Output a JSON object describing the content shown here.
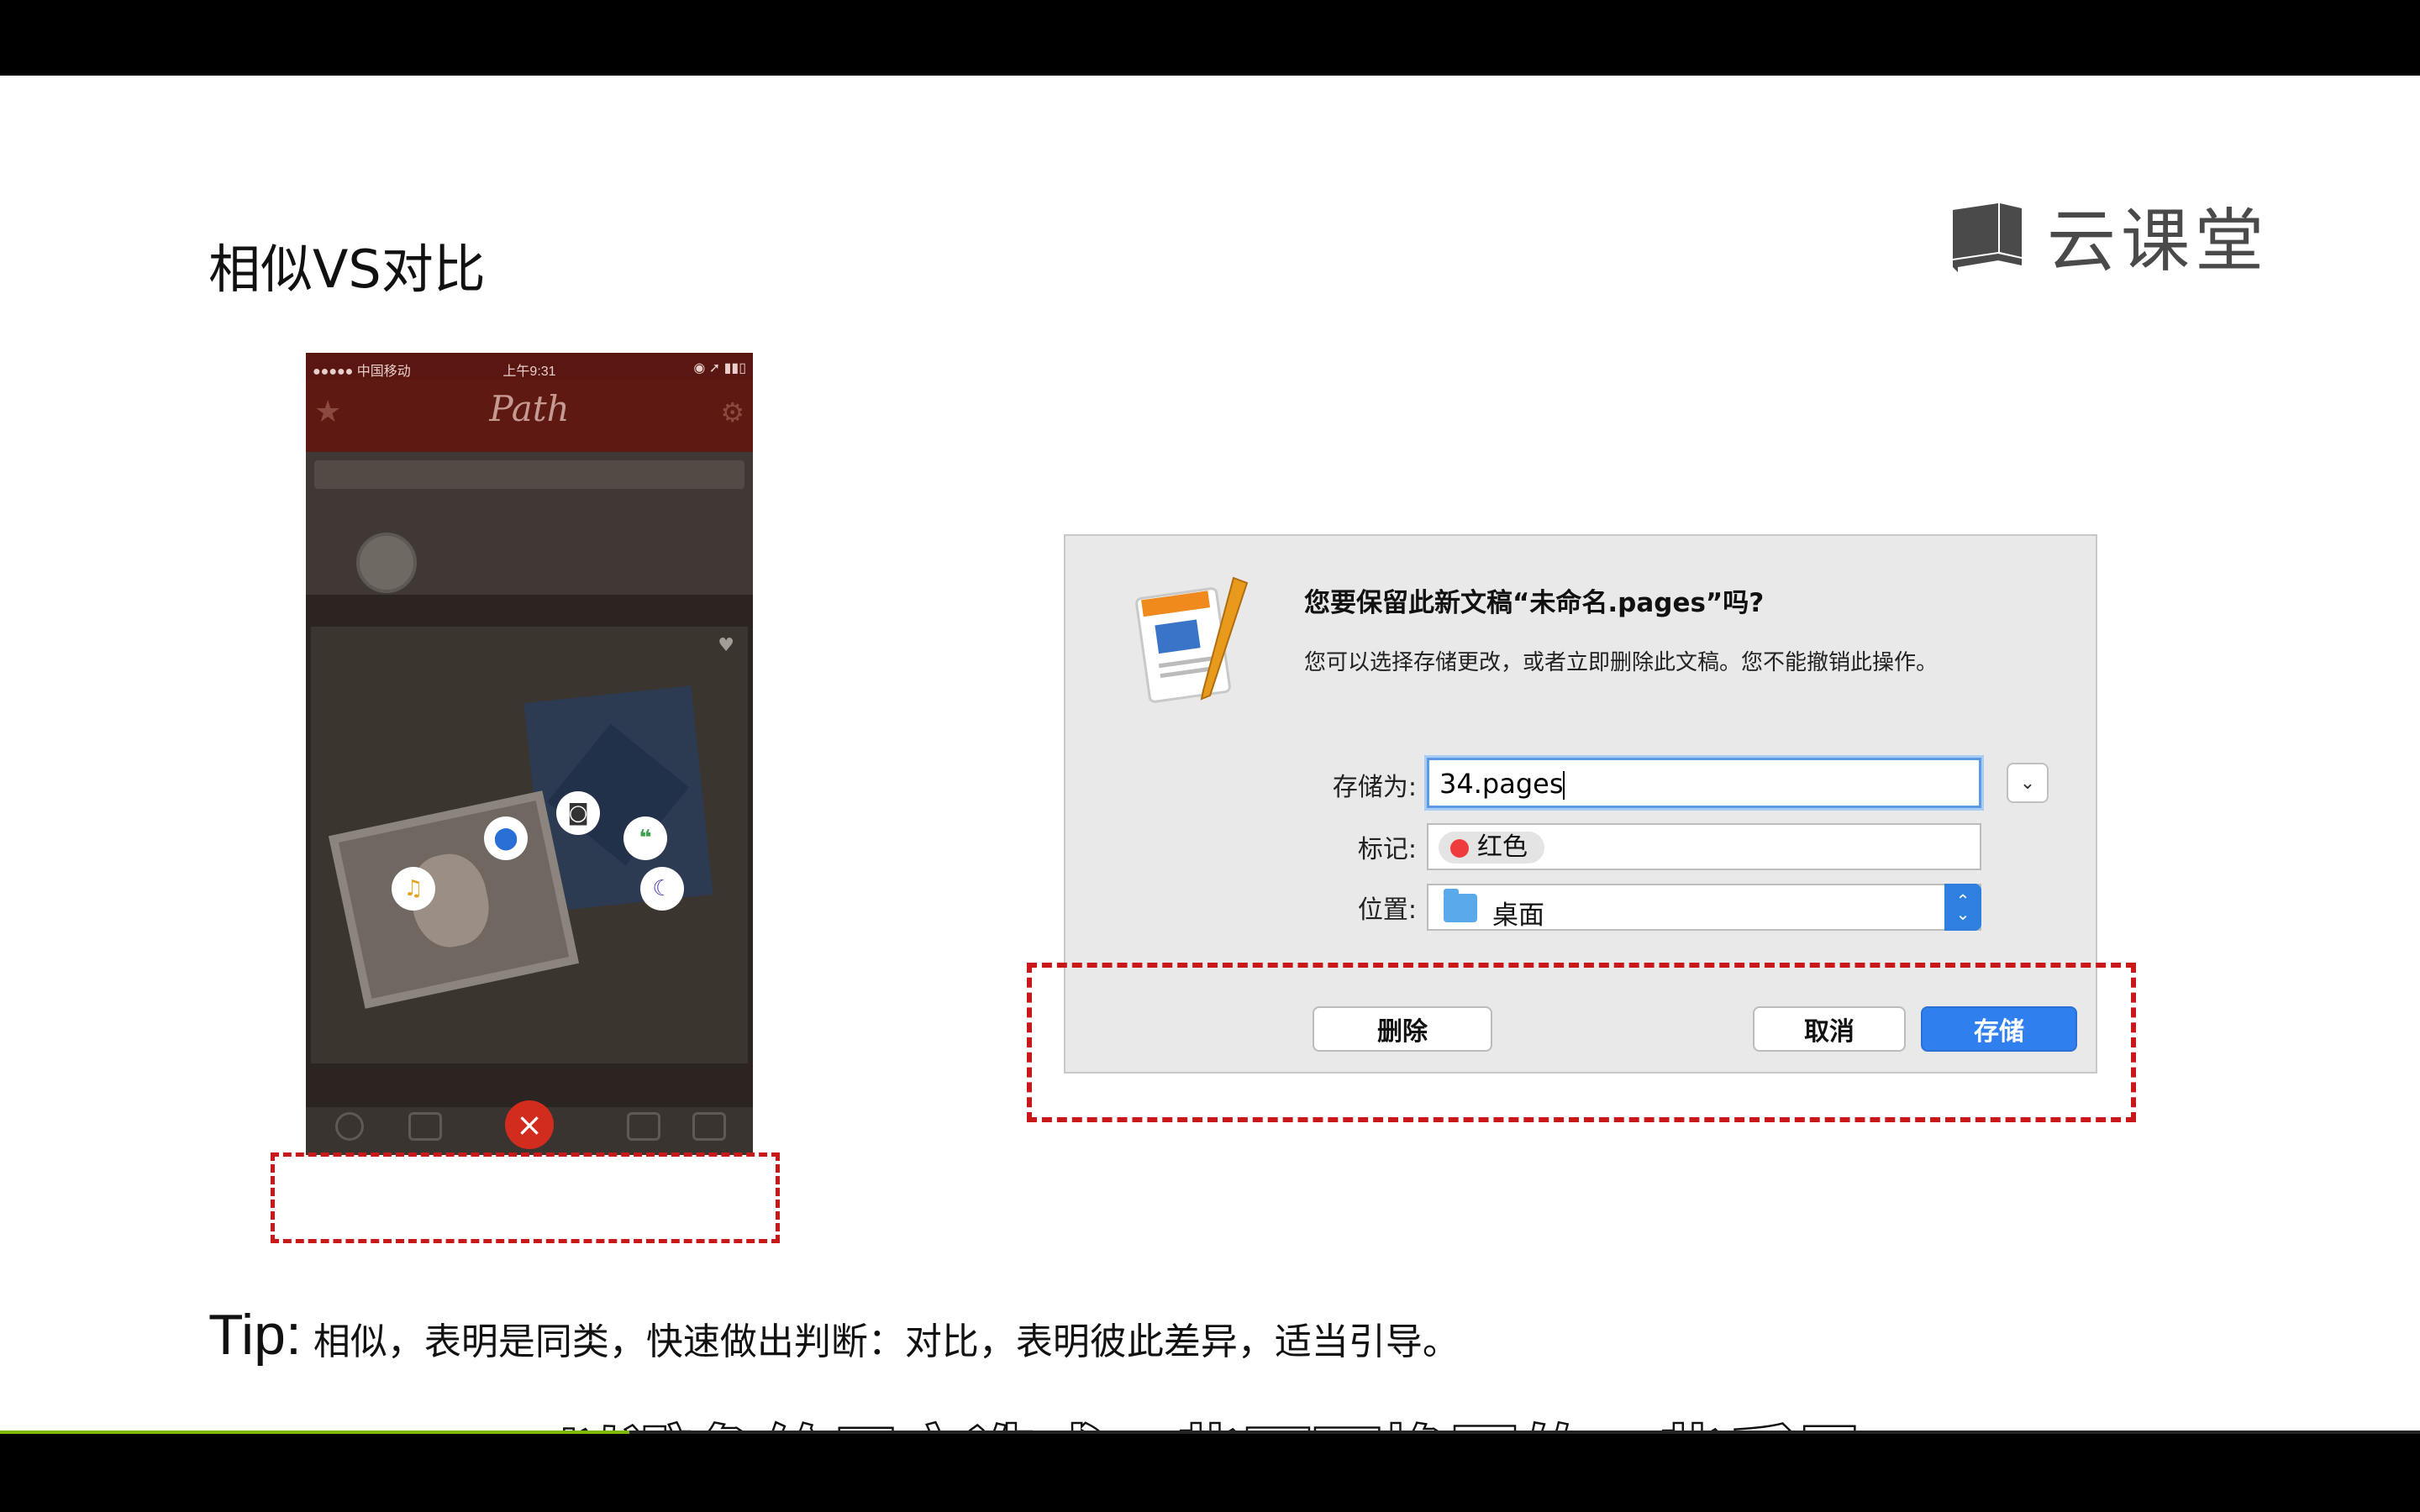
{
  "slide": {
    "title": "相似VS对比",
    "brand": "云课堂",
    "tip_label": "Tip:",
    "tip_text": "相似，表明是同类，快速做出判断：对比，表明彼此差异，适当引导。"
  },
  "phone": {
    "carrier": "●●●●● 中国移动",
    "time": "上午9:31",
    "app_title": "Path",
    "actions": [
      "location-icon",
      "camera-icon",
      "quote-icon",
      "music-icon",
      "moon-icon"
    ],
    "close_icon": "×"
  },
  "dialog": {
    "title": "您要保留此新文稿“未命名.pages”吗?",
    "subtitle": "您可以选择存储更改，或者立即删除此文稿。您不能撤销此操作。",
    "save_as_label": "存储为:",
    "filename": "34.pages",
    "tags_label": "标记:",
    "tag": "红色",
    "tag_color": "#ef3b3b",
    "location_label": "位置:",
    "location": "桌面",
    "delete_button": "删除",
    "cancel_button": "取消",
    "save_button": "存储",
    "accent_color": "#2f80ee"
  },
  "video": {
    "subtitle": "以避免给用户造成一些不可挽回的一些后果",
    "progress": 0.26
  },
  "highlight_color": "#c9181a"
}
